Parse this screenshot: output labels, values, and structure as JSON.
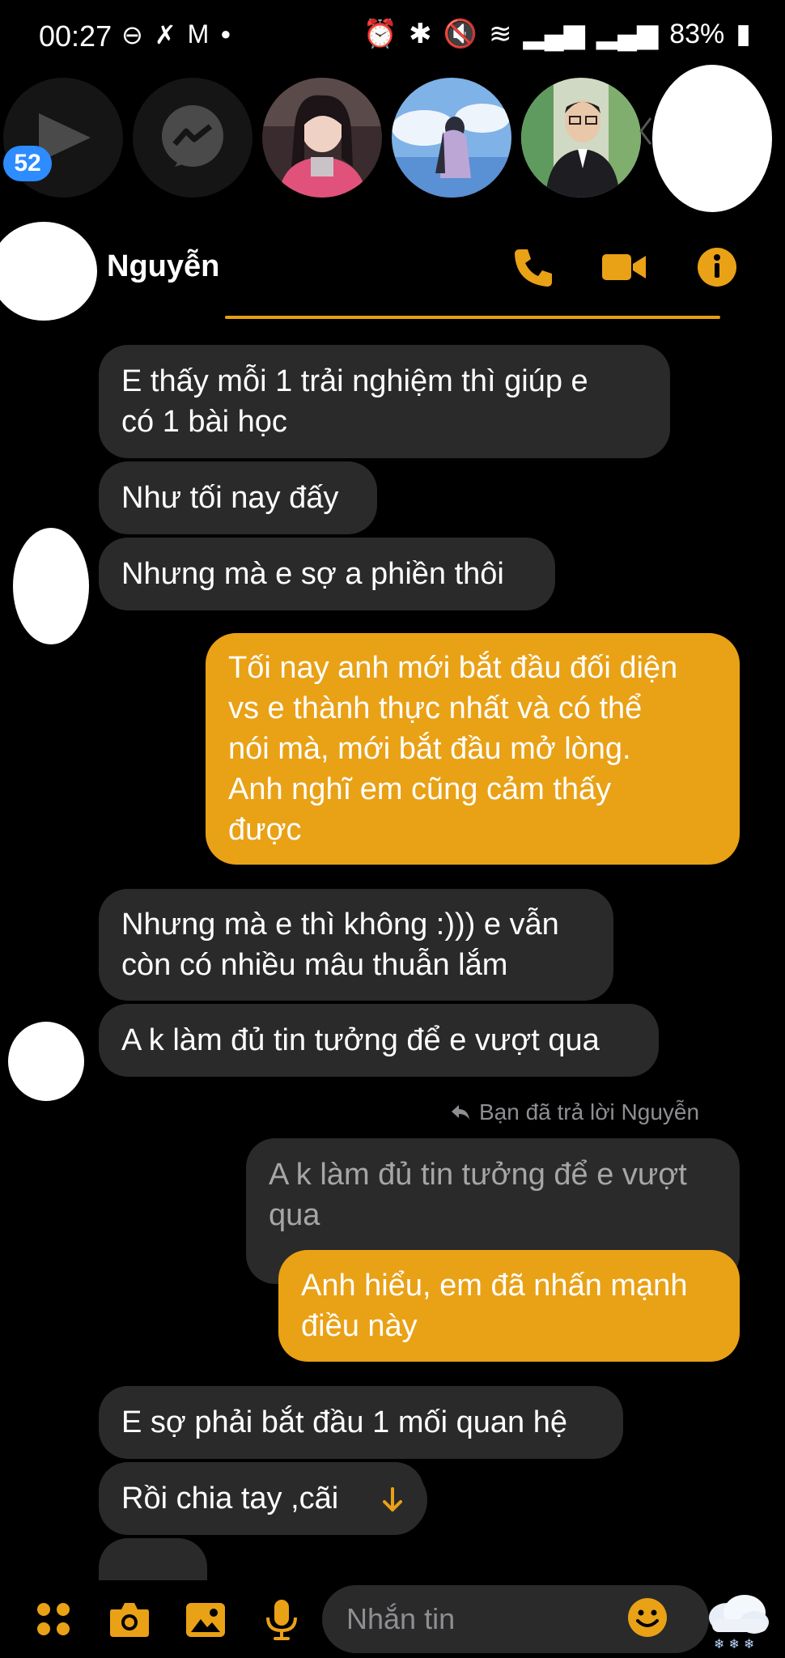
{
  "status_bar": {
    "time": "00:27",
    "battery": "83%",
    "left_icons": [
      "do-not-disturb-icon",
      "missed-call-icon",
      "gmail-icon",
      "dot-icon"
    ],
    "right_icons": [
      "alarm-icon",
      "bluetooth-icon",
      "mute-icon",
      "wifi-icon",
      "signal-icon",
      "signal-icon",
      "battery-icon"
    ]
  },
  "chat_heads": {
    "unread_badge": "52",
    "items": [
      "play-icon",
      "messenger-icon",
      "avatar-girl-pink",
      "avatar-girl-sky",
      "avatar-man-glasses",
      "avatar-hidden"
    ]
  },
  "header": {
    "contact_name": "Nguyễn",
    "actions": [
      "phone-icon",
      "video-icon",
      "info-icon"
    ]
  },
  "messages": {
    "m1": [
      "E thấy mỗi 1 trải nghiệm thì giúp e",
      "có 1 bài học"
    ],
    "m2": "Như tối nay đấy",
    "m3": "Nhưng mà e sợ a phiền thôi",
    "m4": [
      "Tối nay anh mới bắt đầu đối diện",
      "vs e thành thực nhất và có thể",
      "nói mà, mới bắt đầu mở lòng.",
      "Anh nghĩ em cũng cảm thấy",
      "được"
    ],
    "m5": [
      "Nhưng mà e thì không :))) e vẫn",
      "còn có nhiều mâu thuẫn lắm"
    ],
    "m6": "A k làm đủ tin tưởng để e vượt qua",
    "reply_label": "Bạn đã trả lời Nguyễn",
    "quoted": [
      "A k làm đủ tin tưởng để e vượt",
      "qua"
    ],
    "m7": [
      "Anh hiểu, em đã nhấn mạnh",
      "điều này"
    ],
    "m8": "E sợ phải bắt đầu 1 mối quan hệ",
    "m9": "Rồi chia tay ,cãi"
  },
  "composer": {
    "placeholder": "Nhắn tin",
    "icons": [
      "apps-icon",
      "camera-icon",
      "gallery-icon",
      "mic-icon",
      "emoji-icon",
      "weather-snow-icon"
    ]
  },
  "colors": {
    "accent": "#e9a116",
    "incoming_bubble": "#2a2a2a",
    "badge": "#2d8cff",
    "background": "#000000"
  }
}
